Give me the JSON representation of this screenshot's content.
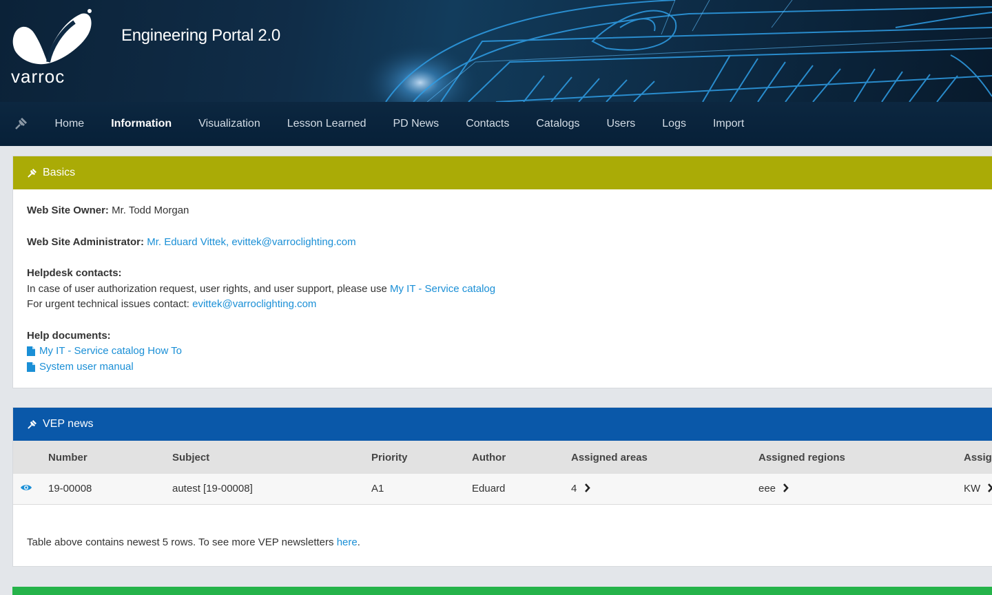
{
  "app": {
    "title": "Engineering Portal 2.0",
    "brand": "varroc"
  },
  "nav": {
    "items": [
      {
        "label": "Home"
      },
      {
        "label": "Information",
        "active": true
      },
      {
        "label": "Visualization"
      },
      {
        "label": "Lesson Learned"
      },
      {
        "label": "PD News"
      },
      {
        "label": "Contacts"
      },
      {
        "label": "Catalogs"
      },
      {
        "label": "Users"
      },
      {
        "label": "Logs"
      },
      {
        "label": "Import"
      }
    ]
  },
  "basics": {
    "title": "Basics",
    "owner_label": "Web Site Owner:",
    "owner_value": "Mr. Todd Morgan",
    "admin_label": "Web Site Administrator:",
    "admin_value": "Mr. Eduard Vittek, evittek@varroclighting.com",
    "helpdesk_label": "Helpdesk contacts:",
    "helpdesk_line1_text": "In case of user authorization request, user rights, and user support, please use",
    "helpdesk_line1_link": "My IT - Service catalog",
    "helpdesk_line2_text": "For urgent technical issues contact:",
    "helpdesk_line2_link": "evittek@varroclighting.com",
    "docs_label": "Help documents:",
    "docs": [
      "My IT - Service catalog How To",
      "System user manual"
    ]
  },
  "vep_news": {
    "title": "VEP news",
    "columns": [
      "Number",
      "Subject",
      "Priority",
      "Author",
      "Assigned areas",
      "Assigned regions",
      "Assig"
    ],
    "rows": [
      {
        "number": "19-00008",
        "subject": "autest [19-00008]",
        "priority": "A1",
        "author": "Eduard",
        "areas": "4",
        "regions": "eee",
        "assig": "KW"
      }
    ],
    "footer_text": "Table above contains newest 5 rows. To see more VEP newsletters",
    "footer_link": "here",
    "footer_end": "."
  },
  "colors": {
    "basics_header": "#aaab06",
    "news_header": "#0a58a9",
    "third_header": "#25b34a",
    "link": "#1a8fd6"
  },
  "icons": {
    "nav_toggle": "pin-icon",
    "panel_header": "pin-icon",
    "doc": "file-icon",
    "view": "eye-icon",
    "expand": "chevron-right-icon"
  }
}
